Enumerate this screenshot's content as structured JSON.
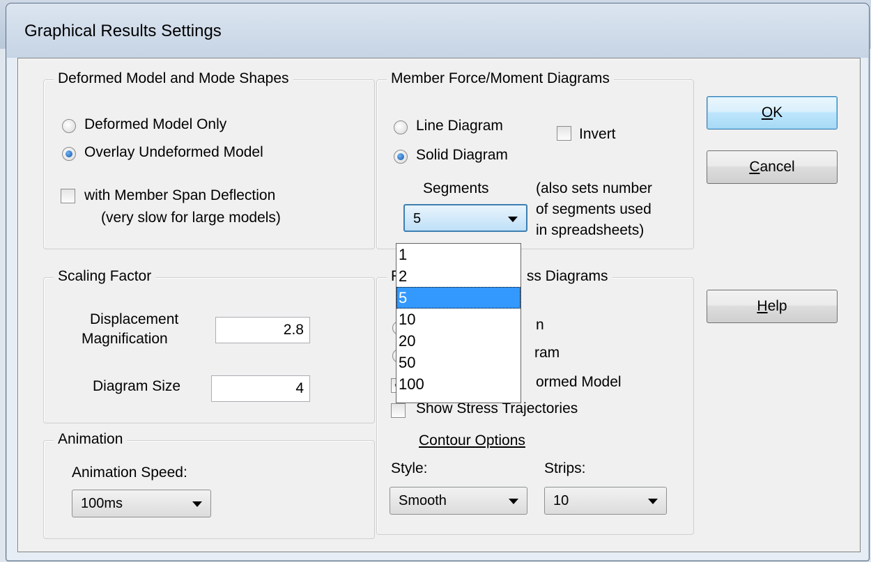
{
  "window": {
    "title": "Graphical Results Settings"
  },
  "deformed": {
    "legend": "Deformed Model and Mode Shapes",
    "radio_only": "Deformed Model Only",
    "radio_overlay": "Overlay Undeformed Model",
    "check_span_line1": "with Member Span Deflection",
    "check_span_line2": "(very slow for large models)"
  },
  "member": {
    "legend": "Member Force/Moment Diagrams",
    "radio_line": "Line Diagram",
    "radio_solid": "Solid Diagram",
    "invert": "Invert",
    "segments_label": "Segments",
    "segments_value": "5",
    "note_line1": "(also sets number",
    "note_line2": "of segments used",
    "note_line3": "in spreadsheets)"
  },
  "segments_options": [
    "1",
    "2",
    "5",
    "10",
    "20",
    "50",
    "100"
  ],
  "segments_selected_index": 2,
  "scaling": {
    "legend": "Scaling Factor",
    "disp_label1": "Displacement",
    "disp_label2": "Magnification",
    "disp_value": "2.8",
    "size_label": "Diagram Size",
    "size_value": "4"
  },
  "plate": {
    "legend_left": "F",
    "legend_right": "ss Diagrams",
    "radio1_tail": "n",
    "radio2_tail": "ram",
    "check_overlay_tail": "ormed Model",
    "check_traj": "Show Stress Trajectories",
    "contour_options": "Contour Options",
    "style_label": "Style:",
    "style_value": "Smooth",
    "strips_label": "Strips:",
    "strips_value": "10"
  },
  "animation": {
    "legend": "Animation",
    "speed_label": "Animation Speed:",
    "speed_value": "100ms"
  },
  "buttons": {
    "ok": "OK",
    "cancel": "Cancel",
    "help": "Help"
  }
}
